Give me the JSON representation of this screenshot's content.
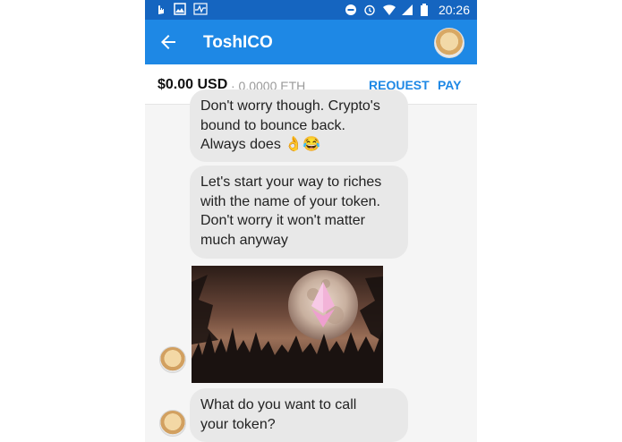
{
  "status_bar": {
    "time": "20:26"
  },
  "app_bar": {
    "title": "ToshICO"
  },
  "wallet": {
    "balance_usd": "$0.00 USD",
    "balance_eth": "· 0.0000 ETH",
    "request_label": "REQUEST",
    "pay_label": "PAY"
  },
  "messages": [
    {
      "line1": "Don't worry though. Crypto's",
      "line2": "bound to bounce back.",
      "line3": "Always does 👌😂"
    },
    {
      "line1": "Let's start your way to riches",
      "line2": "with the name of your token.",
      "line3": "Don't worry it won't matter",
      "line4": "much anyway"
    },
    {
      "line1": "What do you want to call",
      "line2": "your token?"
    }
  ],
  "colors": {
    "app_bar": "#1e88e5",
    "status_bar": "#1565c0",
    "accent": "#1e88e5",
    "bubble": "#e8e8e8"
  }
}
